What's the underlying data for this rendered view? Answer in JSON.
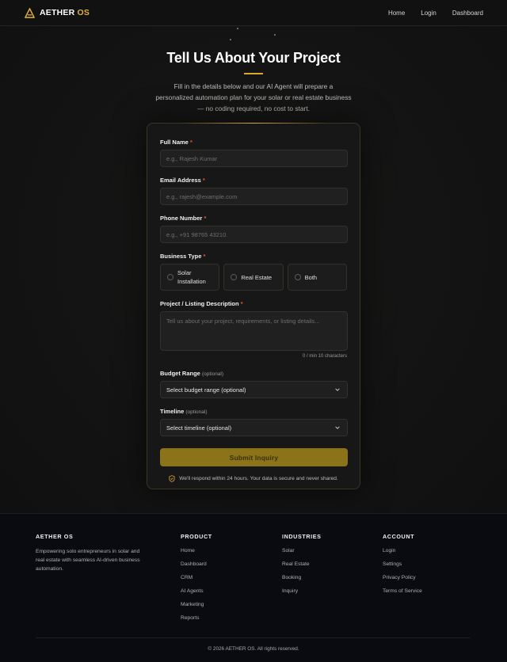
{
  "header": {
    "brand_main": "AETHER",
    "brand_accent": "OS",
    "nav": [
      {
        "label": "Home"
      },
      {
        "label": "Login"
      },
      {
        "label": "Dashboard"
      }
    ]
  },
  "hero": {
    "title": "Tell Us About Your Project",
    "subtitle": "Fill in the details below and our AI Agent will prepare a personalized automation plan for your solar or real estate business — no coding required, no cost to start."
  },
  "form": {
    "full_name": {
      "label": "Full Name",
      "required_mark": "*",
      "placeholder": "e.g., Rajesh Kumar",
      "value": ""
    },
    "email": {
      "label": "Email Address",
      "required_mark": "*",
      "placeholder": "e.g., rajesh@example.com",
      "value": ""
    },
    "phone": {
      "label": "Phone Number",
      "required_mark": "*",
      "placeholder": "e.g., +91 98765 43210",
      "value": ""
    },
    "business_type": {
      "label": "Business Type",
      "required_mark": "*",
      "options": [
        {
          "label": "Solar Installation",
          "selected": false
        },
        {
          "label": "Real Estate",
          "selected": false
        },
        {
          "label": "Both",
          "selected": false
        }
      ]
    },
    "description": {
      "label": "Project / Listing Description",
      "required_mark": "*",
      "placeholder": "Tell us about your project, requirements, or listing details...",
      "value": "",
      "char_count": "0 / min 10 characters"
    },
    "budget": {
      "label": "Budget Range",
      "optional_note": "(optional)",
      "selected": "Select budget range (optional)"
    },
    "timeline": {
      "label": "Timeline",
      "optional_note": "(optional)",
      "selected": "Select timeline (optional)"
    },
    "submit_label": "Submit Inquiry",
    "secure_note": "We'll respond within 24 hours. Your data is secure and never shared."
  },
  "footer": {
    "brand": {
      "heading": "AETHER OS",
      "description": "Empowering solo entrepreneurs in solar and real estate with seamless AI-driven business automation."
    },
    "product": {
      "heading": "PRODUCT",
      "links": [
        "Home",
        "Dashboard",
        "CRM",
        "AI Agents",
        "Marketing",
        "Reports"
      ]
    },
    "industries": {
      "heading": "INDUSTRIES",
      "links": [
        "Solar",
        "Real Estate",
        "Booking",
        "Inquiry"
      ]
    },
    "account": {
      "heading": "ACCOUNT",
      "links": [
        "Login",
        "Settings",
        "Privacy Policy",
        "Terms of Service"
      ]
    },
    "copyright": "© 2026 AETHER OS. All rights reserved."
  },
  "colors": {
    "accent": "#e2b33b",
    "required": "#e05a3a",
    "submit_bg": "#8a7318",
    "background": "#0e0e0f"
  },
  "icons": [
    "aether-logo-icon",
    "radio-circle-icon",
    "chevron-down-icon",
    "shield-check-icon"
  ]
}
